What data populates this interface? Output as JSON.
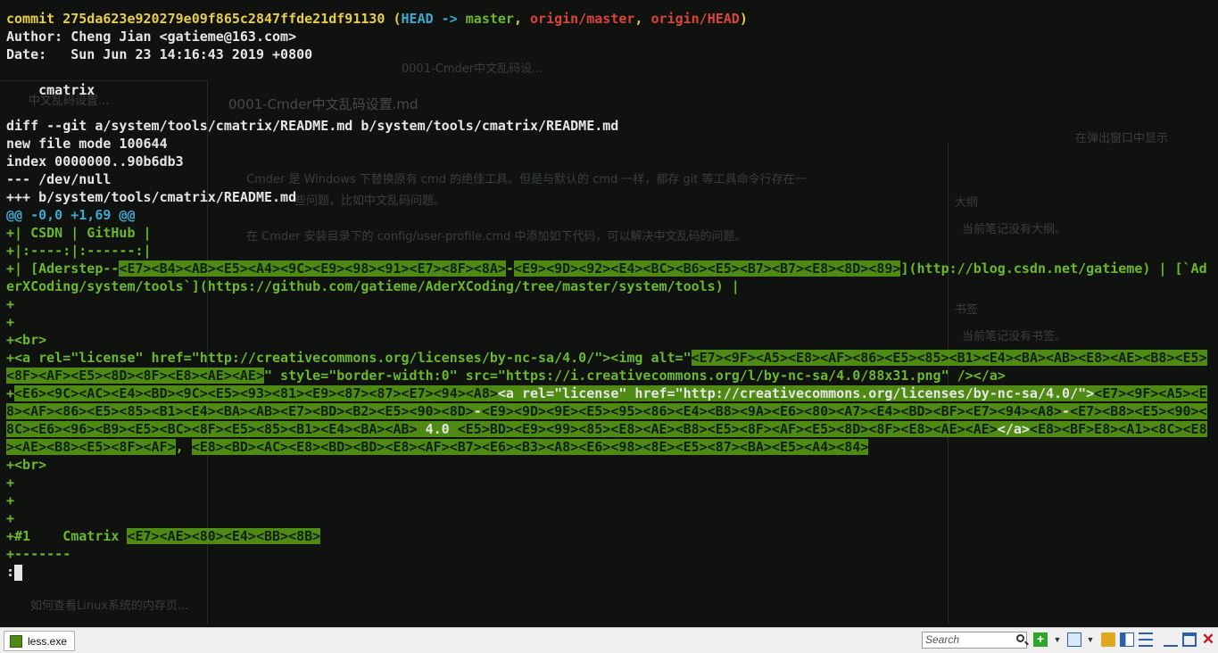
{
  "terminal": {
    "lines": [
      [
        {
          "t": "commit 275da623e920279e09f865c2847ffde21df91130 (",
          "s": "y"
        },
        {
          "t": "HEAD -> ",
          "s": "c"
        },
        {
          "t": "master",
          "s": "g"
        },
        {
          "t": ", ",
          "s": "y"
        },
        {
          "t": "origin/master",
          "s": "r"
        },
        {
          "t": ", ",
          "s": "y"
        },
        {
          "t": "origin/HEAD",
          "s": "r"
        },
        {
          "t": ")",
          "s": "y"
        }
      ],
      [
        {
          "t": "Author: Cheng Jian <gatieme@163.com>",
          "s": ""
        }
      ],
      [
        {
          "t": "Date:   Sun Jun 23 14:16:43 2019 +0800",
          "s": ""
        }
      ],
      [
        {
          "t": "",
          "s": ""
        }
      ],
      [
        {
          "t": "    cmatrix",
          "s": ""
        }
      ],
      [
        {
          "t": "",
          "s": ""
        }
      ],
      [
        {
          "t": "diff --git a/system/tools/cmatrix/README.md b/system/tools/cmatrix/README.md",
          "s": ""
        }
      ],
      [
        {
          "t": "new file mode 100644",
          "s": ""
        }
      ],
      [
        {
          "t": "index 0000000..90b6db3",
          "s": ""
        }
      ],
      [
        {
          "t": "--- /dev/null",
          "s": ""
        }
      ],
      [
        {
          "t": "+++ b/system/tools/cmatrix/README.md",
          "s": ""
        }
      ],
      [
        {
          "t": "@@ -0,0 +1,69 @@",
          "s": "cy"
        }
      ],
      [
        {
          "t": "+| CSDN | GitHub |",
          "s": "g"
        }
      ],
      [
        {
          "t": "+|:----:|:------:|",
          "s": "g"
        }
      ],
      [
        {
          "t": "+| [Aderstep--",
          "s": "g"
        },
        {
          "t": "<E7><B4><AB><E5><A4><9C><E9><98><91><E7><8F><8A>",
          "s": "hl"
        },
        {
          "t": "-",
          "s": "g"
        },
        {
          "t": "<E9><9D><92><E4><BC><B6><E5><B7><B7><E8><8D><89>",
          "s": "hl"
        },
        {
          "t": "](http://blog.csdn.net/gatieme) | [`AderXCoding/system/tools`](https://github.com/gatieme/AderXCoding/tree/master/system/tools) |",
          "s": "g"
        }
      ],
      [
        {
          "t": "+",
          "s": "g"
        }
      ],
      [
        {
          "t": "+",
          "s": "g"
        }
      ],
      [
        {
          "t": "+<br>",
          "s": "g"
        }
      ],
      [
        {
          "t": "+<a rel=\"license\" href=\"http://creativecommons.org/licenses/by-nc-sa/4.0/\"><img alt=\"",
          "s": "g"
        },
        {
          "t": "<E7><9F><A5><E8><AF><86><E5><85><B1><E4><BA><AB><E8><AE><B8><E5><8F><AF><E5><8D><8F><E8><AE><AE>",
          "s": "hl"
        },
        {
          "t": "\" style=\"border-width:0\" src=\"https://i.creativecommons.org/l/by-nc-sa/4.0/88x31.png\" /></a>",
          "s": "g"
        }
      ],
      [
        {
          "t": "+",
          "s": "g"
        },
        {
          "t": "<E6><9C><AC><E4><BD><9C><E5><93><81><E9><87><87><E7><94><A8>",
          "s": "hl"
        },
        {
          "t": "<a rel=\"license\" href=\"http://creativecommons.org/licenses/by-nc-sa/4.0/\">",
          "s": "hl2"
        },
        {
          "t": "<E7><9F><A5><E8><AF><86><E5><85><B1><E4><BA><AB><E7><BD><B2><E5><90><8D>",
          "s": "hl"
        },
        {
          "t": "-",
          "s": "hl2"
        },
        {
          "t": "<E9><9D><9E><E5><95><86><E4><B8><9A><E6><80><A7><E4><BD><BF><E7><94><A8>",
          "s": "hl"
        },
        {
          "t": "-",
          "s": "hl2"
        },
        {
          "t": "<E7><B8><E5><90><8C><E6><96><B9><E5><BC><8F><E5><85><B1><E4><BA><AB>",
          "s": "hl"
        },
        {
          "t": " 4.0 ",
          "s": "hl2"
        },
        {
          "t": "<E5>BD><E9><99><85><E8><AE><B8><E5><8F><AF><E5><8D><8F><E8><AE><AE>",
          "s": "hl"
        },
        {
          "t": "</a>",
          "s": "hl2"
        },
        {
          "t": "<E8><BF>E8><A1><8C><E8><AE><B8><E5><8F><AF>",
          "s": "hl"
        },
        {
          "t": ", ",
          "s": "g"
        },
        {
          "t": "<E8><BD><AC><E8><BD><BD><E8><AF><B7><E6><B3><A8><E6><98><8E><E5><87><BA><E5><A4><84>",
          "s": "hl"
        }
      ],
      [
        {
          "t": "+<br>",
          "s": "g"
        }
      ],
      [
        {
          "t": "+",
          "s": "g"
        }
      ],
      [
        {
          "t": "+",
          "s": "g"
        }
      ],
      [
        {
          "t": "+",
          "s": "g"
        }
      ],
      [
        {
          "t": "+#1    Cmatrix ",
          "s": "g"
        },
        {
          "t": "<E7><AE><80><E4><BB><8B>",
          "s": "hl"
        }
      ],
      [
        {
          "t": "+-------",
          "s": "g"
        }
      ]
    ],
    "prompt": ":"
  },
  "background_ghost": {
    "texts": [
      "0001-Cmder中文乱码设...",
      "0001-Cmder中文乱码设置.md",
      "Cmder 是 Windows 下替换原有 cmd 的绝佳工具。但是与默认的 cmd 一样，都存 git 等工具命令行存在一",
      "些问题，比如中文乱码问题。",
      "在 Cmder 安装目录下的 config/user-profile.cmd 中添加如下代码，可以解决中文乱码的问题。",
      "在弹出窗口中显示",
      "大纲",
      "当前笔记没有大纲。",
      "书签",
      "当前笔记没有书签。",
      "中文乱码设置...",
      "如何查看Linux系统的内存页..."
    ]
  },
  "statusbar": {
    "tab_label": "less.exe",
    "search_placeholder": "Search"
  }
}
